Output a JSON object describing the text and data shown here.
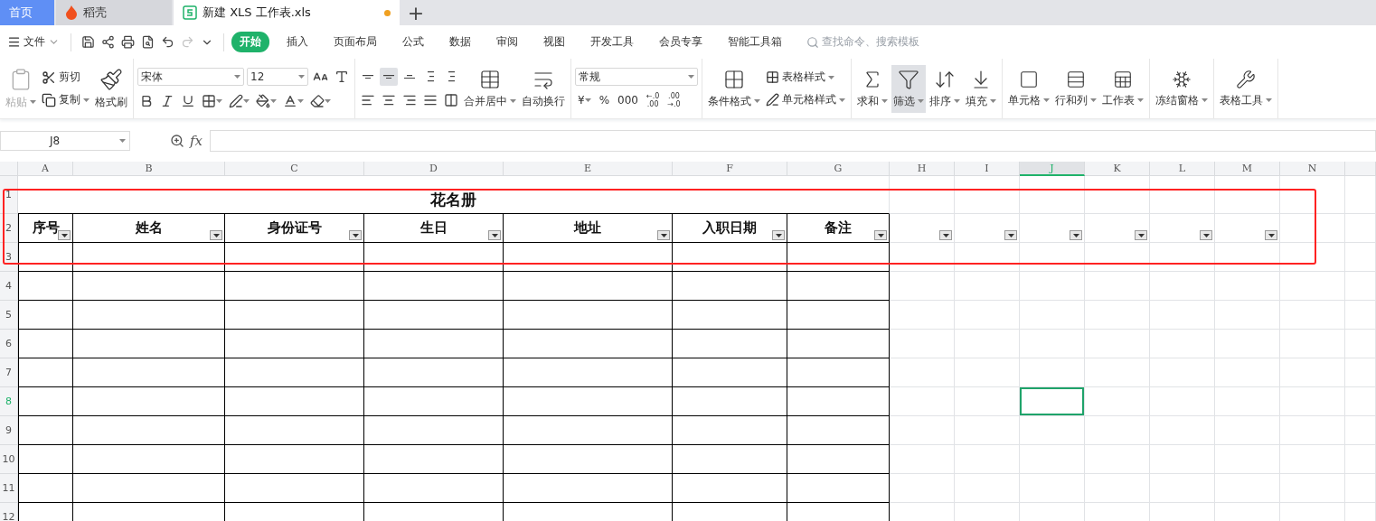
{
  "tabs": [
    {
      "label": "首页",
      "kind": "home",
      "selected": false
    },
    {
      "label": "稻壳",
      "kind": "docer",
      "selected": false
    },
    {
      "label": "新建 XLS 工作表.xls",
      "kind": "sheet",
      "selected": true,
      "unsaved": true
    }
  ],
  "new_tab": "+",
  "menu": {
    "file": "文件",
    "items": [
      {
        "label": "开始",
        "selected": true
      },
      {
        "label": "插入",
        "selected": false
      },
      {
        "label": "页面布局",
        "selected": false
      },
      {
        "label": "公式",
        "selected": false
      },
      {
        "label": "数据",
        "selected": false
      },
      {
        "label": "审阅",
        "selected": false
      },
      {
        "label": "视图",
        "selected": false
      },
      {
        "label": "开发工具",
        "selected": false
      },
      {
        "label": "会员专享",
        "selected": false
      },
      {
        "label": "智能工具箱",
        "selected": false
      }
    ],
    "search_placeholder": "查找命令、搜索模板"
  },
  "ribbon": {
    "paste": {
      "label": "粘贴",
      "disabled": true
    },
    "clipboard": [
      {
        "label": "剪切",
        "dropdown": false
      },
      {
        "label": "复制",
        "dropdown": true
      }
    ],
    "format_painter": "格式刷",
    "font_name": "宋体",
    "font_size": "12",
    "font_buttons": [
      {
        "dropdown": false
      },
      {
        "dropdown": false
      },
      {
        "dropdown": false
      },
      {
        "dropdown": true
      },
      {
        "dropdown": true
      },
      {
        "dropdown": true
      },
      {
        "dropdown": true
      },
      {
        "dropdown": true
      }
    ],
    "align_top": [
      {
        "selected": false
      },
      {
        "selected": true
      },
      {
        "selected": false
      },
      {
        "selected": false
      },
      {
        "selected": false
      }
    ],
    "align_bottom": [
      {
        "selected": false
      },
      {
        "selected": false
      },
      {
        "selected": false
      },
      {
        "selected": false
      },
      {
        "selected": false
      }
    ],
    "merge": {
      "label": "合并居中",
      "dropdown": true
    },
    "wrap": {
      "label": "自动换行",
      "dropdown": false
    },
    "number_format": "常规",
    "number_buttons": [
      {
        "text": "¥",
        "dropdown": true
      },
      {
        "text": "%"
      },
      {
        "text": "000"
      },
      {
        "top": "←.0",
        "bottom": ".00"
      },
      {
        "top": ".00",
        "bottom": "→.0"
      }
    ],
    "styles": {
      "conditional": "条件格式",
      "table_style": "表格样式",
      "cell_style": "单元格样式"
    },
    "tools": [
      {
        "label": "求和",
        "selected": false
      },
      {
        "label": "筛选",
        "selected": true
      },
      {
        "label": "排序",
        "selected": false
      },
      {
        "label": "填充",
        "selected": false
      }
    ],
    "structure": [
      {
        "label": "单元格"
      },
      {
        "label": "行和列"
      },
      {
        "label": "工作表"
      }
    ],
    "freeze": "冻结窗格",
    "table_tools": "表格工具"
  },
  "formula_bar": {
    "name_box": "J8",
    "function_label": "fx"
  },
  "sheet": {
    "columns": [
      {
        "label": "A",
        "selected": false,
        "filter": true
      },
      {
        "label": "B",
        "selected": false,
        "filter": true
      },
      {
        "label": "C",
        "selected": false,
        "filter": true
      },
      {
        "label": "D",
        "selected": false,
        "filter": true
      },
      {
        "label": "E",
        "selected": false,
        "filter": true
      },
      {
        "label": "F",
        "selected": false,
        "filter": true
      },
      {
        "label": "G",
        "selected": false,
        "filter": true
      },
      {
        "label": "H",
        "selected": false,
        "filter": true
      },
      {
        "label": "I",
        "selected": false,
        "filter": true
      },
      {
        "label": "J",
        "selected": true,
        "filter": true
      },
      {
        "label": "K",
        "selected": false,
        "filter": true
      },
      {
        "label": "L",
        "selected": false,
        "filter": true
      },
      {
        "label": "M",
        "selected": false,
        "filter": true
      },
      {
        "label": "N",
        "selected": false,
        "filter": false
      },
      {
        "selected": false,
        "filter": false
      }
    ],
    "rows": [
      {
        "label": "1",
        "selected": false
      },
      {
        "label": "2",
        "selected": false
      },
      {
        "label": "3",
        "selected": false
      },
      {
        "label": "4",
        "selected": false
      },
      {
        "label": "5",
        "selected": false
      },
      {
        "label": "6",
        "selected": false
      },
      {
        "label": "7",
        "selected": false
      },
      {
        "label": "8",
        "selected": true
      },
      {
        "label": "9",
        "selected": false
      },
      {
        "label": "10",
        "selected": false
      },
      {
        "label": "11",
        "selected": false
      },
      {
        "label": "12",
        "selected": false
      }
    ],
    "title": "花名册",
    "headers": [
      "序号",
      "姓名",
      "身份证号",
      "生日",
      "地址",
      "入职日期",
      "备注"
    ]
  },
  "annotation": {
    "kind": "frame"
  }
}
